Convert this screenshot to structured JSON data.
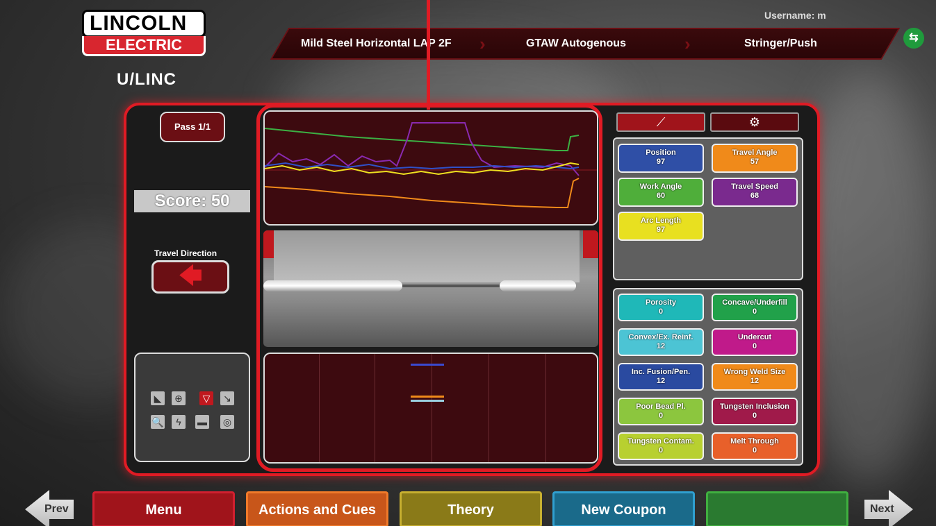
{
  "header": {
    "logo_top": "LINCOLN",
    "logo_bottom": "ELECTRIC",
    "brand": "U/LINC",
    "username": "Username: m",
    "breadcrumb": [
      "Mild Steel Horizontal LAP 2F",
      "GTAW Autogenous",
      "Stringer/Push"
    ],
    "usb_icon": "usb-icon"
  },
  "left": {
    "pass": "Pass 1/1",
    "score": "Score: 50",
    "travel_direction_label": "Travel Direction",
    "travel_direction_icon": "arrow-left-icon"
  },
  "tabs": {
    "tab1_icon": "torch-icon",
    "tab2_icon": "gear-icon"
  },
  "params": [
    {
      "name": "Position",
      "value": "97",
      "color": "#2f4fa6"
    },
    {
      "name": "Travel Angle",
      "value": "57",
      "color": "#f08a1a"
    },
    {
      "name": "Work Angle",
      "value": "60",
      "color": "#4fae3a"
    },
    {
      "name": "Travel Speed",
      "value": "68",
      "color": "#7a2a8e"
    },
    {
      "name": "Arc Length",
      "value": "97",
      "color": "#e8e020"
    }
  ],
  "defects": [
    {
      "name": "Porosity",
      "value": "0",
      "color": "#1fb8b8"
    },
    {
      "name": "Concave/Underfill",
      "value": "0",
      "color": "#21a14a"
    },
    {
      "name": "Convex/Ex. Reinf.",
      "value": "12",
      "color": "#4cc4d4"
    },
    {
      "name": "Undercut",
      "value": "0",
      "color": "#c01a8a"
    },
    {
      "name": "Inc. Fusion/Pen.",
      "value": "12",
      "color": "#2a4aa0"
    },
    {
      "name": "Wrong Weld Size",
      "value": "12",
      "color": "#f08a1a"
    },
    {
      "name": "Poor Bead Pl.",
      "value": "0",
      "color": "#8cc63e"
    },
    {
      "name": "Tungsten Inclusion",
      "value": "0",
      "color": "#a01a4a"
    },
    {
      "name": "Tungsten Contam.",
      "value": "0",
      "color": "#b8d030"
    },
    {
      "name": "Melt Through",
      "value": "0",
      "color": "#e8602a"
    }
  ],
  "bottom": {
    "prev": "Prev",
    "next": "Next",
    "menu": "Menu",
    "actions": "Actions and Cues",
    "theory": "Theory",
    "new_coupon": "New Coupon",
    "blank": ""
  }
}
